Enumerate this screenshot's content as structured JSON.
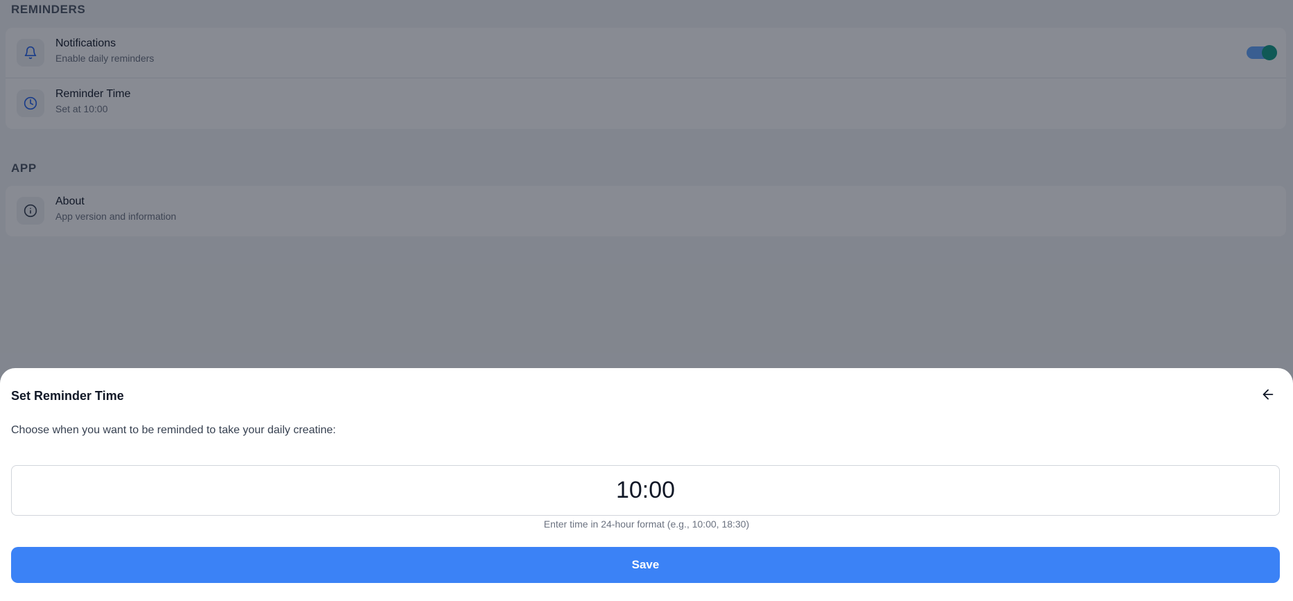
{
  "sections": {
    "reminders": {
      "title": "REMINDERS",
      "notifications": {
        "icon": "bell-icon",
        "title": "Notifications",
        "subtitle": "Enable daily reminders",
        "toggle_on": true
      },
      "reminder_time": {
        "icon": "clock-icon",
        "title": "Reminder Time",
        "subtitle": "Set at 10:00"
      }
    },
    "app": {
      "title": "APP",
      "about": {
        "icon": "info-icon",
        "title": "About",
        "subtitle": "App version and information"
      }
    }
  },
  "sheet": {
    "title": "Set Reminder Time",
    "back_icon": "arrow-left-icon",
    "description": "Choose when you want to be reminded to take your daily creatine:",
    "time_value": "10:00",
    "hint": "Enter time in 24-hour format (e.g., 10:00, 18:30)",
    "save_label": "Save"
  },
  "colors": {
    "accent": "#3b82f6",
    "toggle_knob": "#0f9b84",
    "icon_blue": "#2563eb"
  }
}
